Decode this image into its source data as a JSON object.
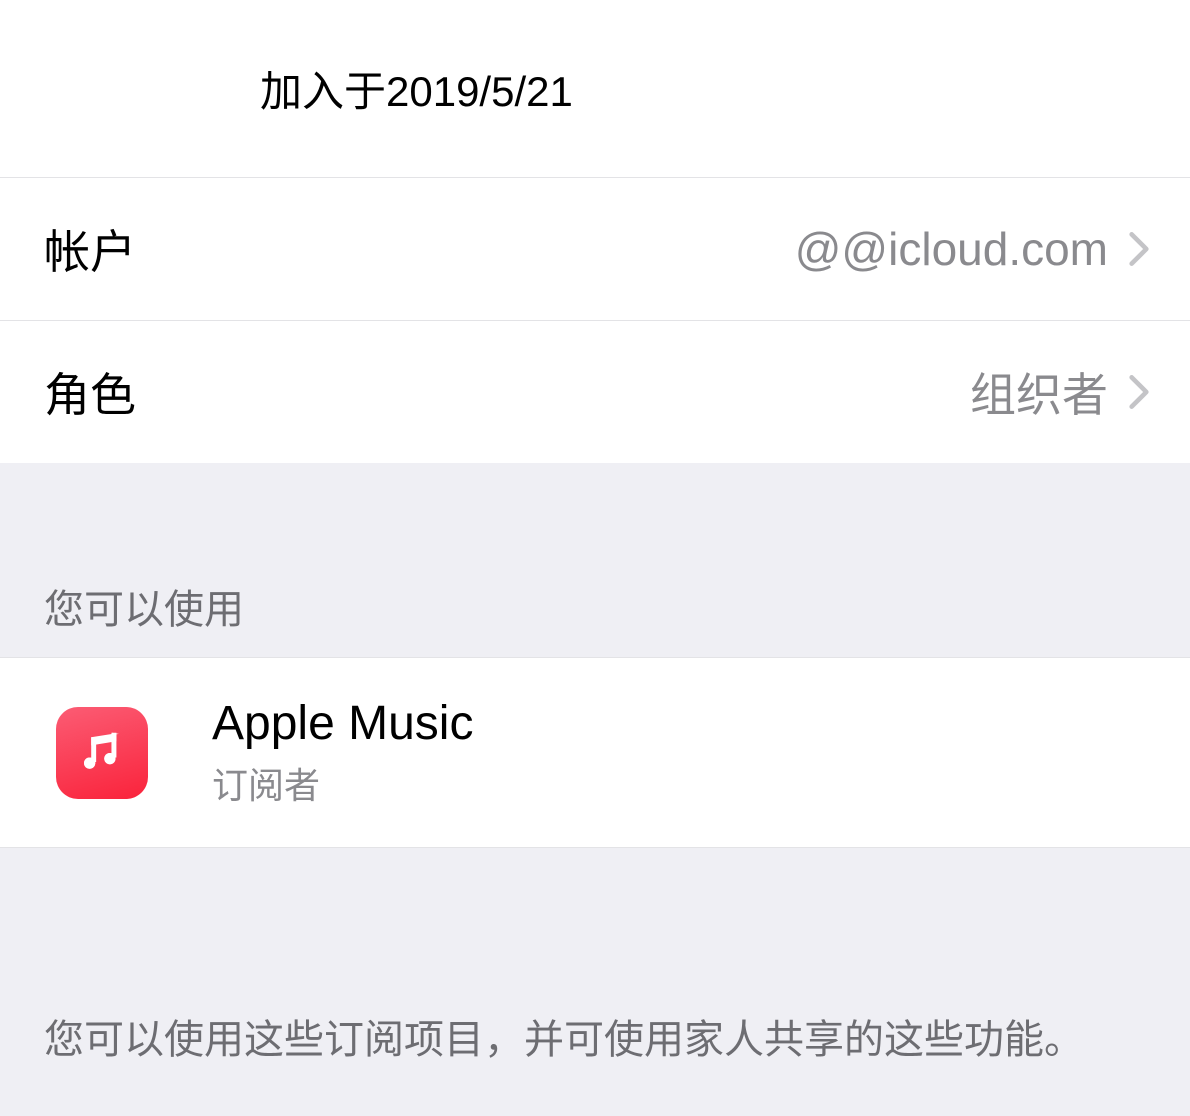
{
  "header": {
    "joined_date": "加入于2019/5/21"
  },
  "account_row": {
    "label": "帐户",
    "value": "@@icloud.com"
  },
  "role_row": {
    "label": "角色",
    "value": "组织者"
  },
  "available_section": {
    "header": "您可以使用",
    "app": {
      "title": "Apple Music",
      "subtitle": "订阅者"
    }
  },
  "footer": {
    "text": "您可以使用这些订阅项目，并可使用家人共享的这些功能。"
  }
}
